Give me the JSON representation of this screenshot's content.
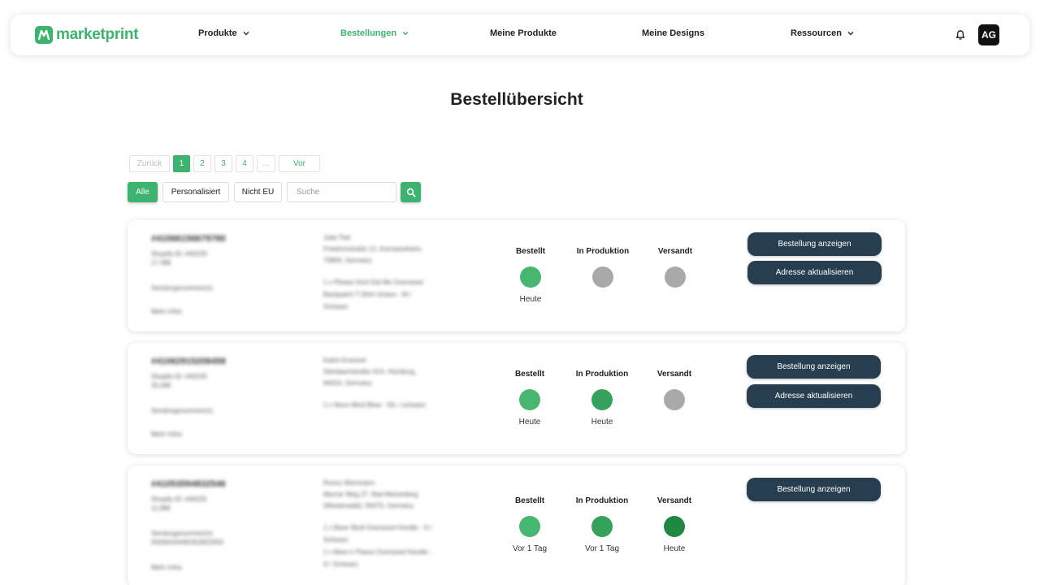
{
  "app": {
    "logo_text": "marketprint",
    "brand_color": "#3cb36e",
    "accent_dark": "#263e4f"
  },
  "nav": {
    "items": [
      {
        "label": "Produkte",
        "has_dropdown": true,
        "active": false
      },
      {
        "label": "Bestellungen",
        "has_dropdown": true,
        "active": true
      },
      {
        "label": "Meine Produkte",
        "has_dropdown": false,
        "active": false
      },
      {
        "label": "Meine Designs",
        "has_dropdown": false,
        "active": false
      },
      {
        "label": "Ressourcen",
        "has_dropdown": true,
        "active": false
      }
    ],
    "notification_icon": "bell-icon",
    "avatar_initials": "AG"
  },
  "page": {
    "title": "Bestellübersicht"
  },
  "pagination": {
    "prev": "Zurück",
    "pages": [
      "1",
      "2",
      "3",
      "4",
      "..."
    ],
    "current": "1",
    "next": "Vor"
  },
  "filters": {
    "all": "Alle",
    "personalized": "Personalisiert",
    "non_eu": "Nicht EU",
    "search_placeholder": "Suche",
    "search_icon": "search-icon"
  },
  "status_colors": {
    "pending": "#a9a9a9",
    "ordered": "#47b66e",
    "production": "#35a25b",
    "shipped": "#1f8840"
  },
  "orders": [
    {
      "order_number": "#41066156679780",
      "shop_ref": "Shopify-ID: #40229",
      "amount": "17,39€",
      "tracking": "Sendungsnummer(n):",
      "more": "Mehr Infos",
      "address": [
        "Julia Tiek",
        "Friedrichstraße 12, Kornwestheim,",
        "70806, Germany"
      ],
      "items": [
        "1 x Please Dont Eat Me Oversized",
        "Backpatch T-Shirt Unisex - M /",
        "Schwarz"
      ],
      "statuses": [
        {
          "label": "Bestellt",
          "date": "Heute",
          "state": "ordered"
        },
        {
          "label": "In Produktion",
          "date": "",
          "state": "pending"
        },
        {
          "label": "Versandt",
          "date": "",
          "state": "pending"
        }
      ],
      "actions": [
        "Bestellung anzeigen",
        "Adresse aktualisieren"
      ]
    },
    {
      "order_number": "#41062915208458",
      "shop_ref": "Shopify-ID: #40226",
      "amount": "33,49€",
      "tracking": "Sendungsnummer(n):",
      "more": "Mehr Infos",
      "address": [
        "Katrin Koennel",
        "Steinbachstraße 41A, Homburg,",
        "66424, Germany"
      ],
      "items": [
        "1 x Neon Mind Blow - S/L / schwarz"
      ],
      "statuses": [
        {
          "label": "Bestellt",
          "date": "Heute",
          "state": "ordered"
        },
        {
          "label": "In Produktion",
          "date": "Heute",
          "state": "production"
        },
        {
          "label": "Versandt",
          "date": "",
          "state": "pending"
        }
      ],
      "actions": [
        "Bestellung anzeigen",
        "Adresse aktualisieren"
      ]
    },
    {
      "order_number": "#41053594832546",
      "shop_ref": "Shopify-ID: #40225",
      "amount": "11,96€",
      "tracking": "Sendungsnummer(n):",
      "tracking_number": "00340434490302822002",
      "more": "Mehr Infos",
      "address": [
        "Ronny Wichmann",
        "Marner Weg 27, Bad Marienberg",
        "(Westerwald), 56470, Germany"
      ],
      "items": [
        "1 x Bave Skull Oversized Hoodie - S /",
        "Schwarz",
        "1 x Bave ir Peace Oversized Hoodie -",
        "S / Schwarz"
      ],
      "statuses": [
        {
          "label": "Bestellt",
          "date": "Vor 1 Tag",
          "state": "ordered"
        },
        {
          "label": "In Produktion",
          "date": "Vor 1 Tag",
          "state": "production"
        },
        {
          "label": "Versandt",
          "date": "Heute",
          "state": "shipped"
        }
      ],
      "actions": [
        "Bestellung anzeigen"
      ]
    }
  ]
}
